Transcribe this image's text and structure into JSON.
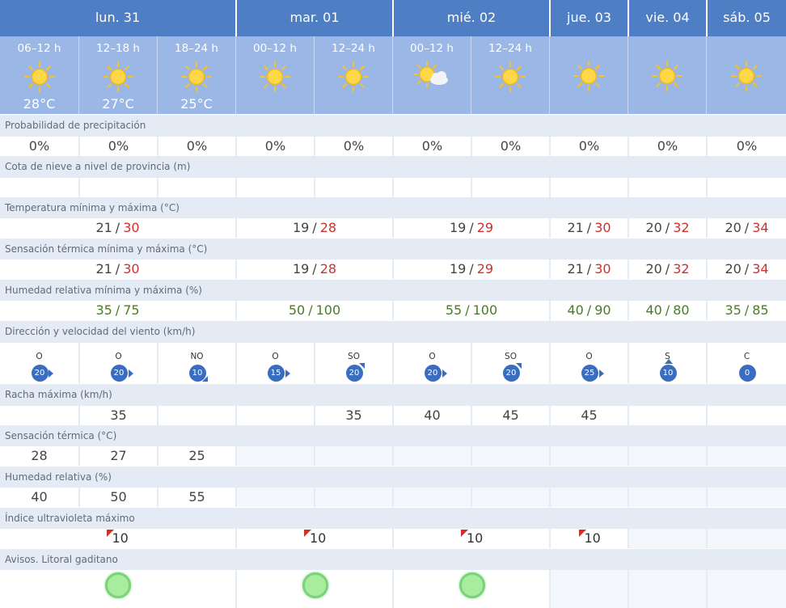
{
  "days": [
    {
      "label": "lun. 31"
    },
    {
      "label": "mar. 01"
    },
    {
      "label": "mié. 02"
    },
    {
      "label": "jue. 03"
    },
    {
      "label": "vie. 04"
    },
    {
      "label": "sáb. 05"
    }
  ],
  "periods": [
    {
      "label": "06–12 h",
      "temp": "28°C",
      "icon": "sun-icon"
    },
    {
      "label": "12–18 h",
      "temp": "27°C",
      "icon": "sun-icon"
    },
    {
      "label": "18–24 h",
      "temp": "25°C",
      "icon": "sun-icon"
    },
    {
      "label": "00–12 h",
      "temp": "",
      "icon": "sun-icon"
    },
    {
      "label": "12–24 h",
      "temp": "",
      "icon": "sun-icon"
    },
    {
      "label": "00–12 h",
      "temp": "",
      "icon": "sun-cloud-icon"
    },
    {
      "label": "12–24 h",
      "temp": "",
      "icon": "sun-icon"
    },
    {
      "label": "",
      "temp": "",
      "icon": "sun-icon"
    },
    {
      "label": "",
      "temp": "",
      "icon": "sun-icon"
    },
    {
      "label": "",
      "temp": "",
      "icon": "sun-icon"
    }
  ],
  "labels": {
    "precip": "Probabilidad de precipitación",
    "snow": "Cota de nieve a nivel de provincia (m)",
    "temp": "Temperatura mínima y máxima (°C)",
    "feel": "Sensación térmica mínima y máxima (°C)",
    "hum": "Humedad relativa mínima y máxima (%)",
    "wind": "Dirección y velocidad del viento (km/h)",
    "gust": "Racha máxima (km/h)",
    "feelnow": "Sensación térmica (°C)",
    "humnow": "Humedad relativa (%)",
    "uv": "Índice ultravioleta máximo",
    "warn": "Avisos. Litoral gaditano"
  },
  "precip": [
    "0%",
    "0%",
    "0%",
    "0%",
    "0%",
    "0%",
    "0%",
    "0%",
    "0%",
    "0%"
  ],
  "temp": [
    {
      "min": "21",
      "max": "30"
    },
    {
      "min": "19",
      "max": "28"
    },
    {
      "min": "19",
      "max": "29"
    },
    {
      "min": "21",
      "max": "30"
    },
    {
      "min": "20",
      "max": "32"
    },
    {
      "min": "20",
      "max": "34"
    }
  ],
  "feel": [
    {
      "min": "21",
      "max": "30"
    },
    {
      "min": "19",
      "max": "28"
    },
    {
      "min": "19",
      "max": "29"
    },
    {
      "min": "21",
      "max": "30"
    },
    {
      "min": "20",
      "max": "32"
    },
    {
      "min": "20",
      "max": "34"
    }
  ],
  "hum": [
    {
      "min": "35",
      "max": "75"
    },
    {
      "min": "50",
      "max": "100"
    },
    {
      "min": "55",
      "max": "100"
    },
    {
      "min": "40",
      "max": "90"
    },
    {
      "min": "40",
      "max": "80"
    },
    {
      "min": "35",
      "max": "85"
    }
  ],
  "sep": "/",
  "wind": [
    {
      "dir": "O",
      "speed": "20",
      "arrow": "e"
    },
    {
      "dir": "O",
      "speed": "20",
      "arrow": "e"
    },
    {
      "dir": "NO",
      "speed": "10",
      "arrow": "se"
    },
    {
      "dir": "O",
      "speed": "15",
      "arrow": "e"
    },
    {
      "dir": "SO",
      "speed": "20",
      "arrow": "ne"
    },
    {
      "dir": "O",
      "speed": "20",
      "arrow": "e"
    },
    {
      "dir": "SO",
      "speed": "20",
      "arrow": "ne"
    },
    {
      "dir": "O",
      "speed": "25",
      "arrow": "e"
    },
    {
      "dir": "S",
      "speed": "10",
      "arrow": "n"
    },
    {
      "dir": "C",
      "speed": "0",
      "arrow": ""
    }
  ],
  "gust": [
    "",
    "35",
    "",
    "",
    "35",
    "40",
    "45",
    "45",
    "",
    ""
  ],
  "feelnow": [
    "28",
    "27",
    "25"
  ],
  "humnow": [
    "40",
    "50",
    "55"
  ],
  "uv": [
    "10",
    "10",
    "10",
    "10"
  ],
  "colors": {
    "header": "#4e7fc4",
    "subheader": "#9bb7e6",
    "label_bg": "#e4ebf5",
    "max": "#d0302e",
    "humidity": "#4b7a2c",
    "wind_badge": "#3a6dbf",
    "warning_green": "#a8ec9e"
  }
}
